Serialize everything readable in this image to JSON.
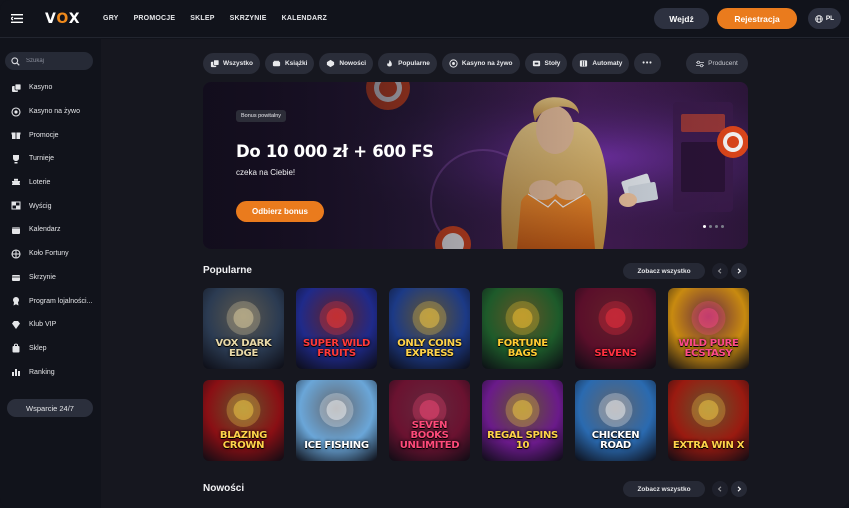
{
  "brand": {
    "logo_v": "V",
    "logo_o": "O",
    "logo_x": "X",
    "accent": "#ea7b1d"
  },
  "nav": [
    "GRY",
    "PROMOCJE",
    "SKLEP",
    "SKRZYNIE",
    "KALENDARZ"
  ],
  "header": {
    "login": "Wejdź",
    "register": "Rejestracja",
    "lang": "PL"
  },
  "search": {
    "placeholder": "Szukaj"
  },
  "sidebar": {
    "items": [
      {
        "label": "Kasyno",
        "icon": "dice-icon"
      },
      {
        "label": "Kasyno na żywo",
        "icon": "live-icon"
      },
      {
        "label": "Promocje",
        "icon": "gift-icon"
      },
      {
        "label": "Turnieje",
        "icon": "trophy-icon"
      },
      {
        "label": "Loterie",
        "icon": "ticket-icon"
      },
      {
        "label": "Wyścig",
        "icon": "flag-icon"
      },
      {
        "label": "Kalendarz",
        "icon": "calendar-icon"
      },
      {
        "label": "Koło Fortuny",
        "icon": "wheel-icon"
      },
      {
        "label": "Skrzynie",
        "icon": "chest-icon"
      },
      {
        "label": "Program lojalności...",
        "icon": "loyalty-icon"
      },
      {
        "label": "Klub VIP",
        "icon": "diamond-icon"
      },
      {
        "label": "Sklep",
        "icon": "bag-icon"
      },
      {
        "label": "Ranking",
        "icon": "ranking-icon"
      }
    ],
    "support": "Wsparcie 24/7"
  },
  "categories": [
    {
      "label": "Wszystko"
    },
    {
      "label": "Książki"
    },
    {
      "label": "Nowości"
    },
    {
      "label": "Popularne"
    },
    {
      "label": "Kasyno na żywo"
    },
    {
      "label": "Stoły"
    },
    {
      "label": "Automaty"
    }
  ],
  "more_label": "•••",
  "producer": "Producent",
  "hero": {
    "badge": "Bonus powitalny",
    "title": "Do 10 000 zł + 600 FS",
    "subtitle": "czeka na Ciebie!",
    "cta": "Odbierz bonus"
  },
  "sections": {
    "popular": "Popularne",
    "new": "Nowości",
    "see_all": "Zobacz wszystko"
  },
  "games": [
    {
      "name": "VOX DARK EDGE",
      "bg": "#2b3b52",
      "fg": "#e8d9a8"
    },
    {
      "name": "SUPER WILD FRUITS",
      "bg": "#1f2a8a",
      "fg": "#ff3a3a"
    },
    {
      "name": "ONLY COINS EXPRESS",
      "bg": "#1c3a86",
      "fg": "#ffd34a"
    },
    {
      "name": "FORTUNE BAGS",
      "bg": "#1d5a2a",
      "fg": "#ffcc33"
    },
    {
      "name": "SEVENS",
      "bg": "#5a0f2a",
      "fg": "#ff3040"
    },
    {
      "name": "WILD PURE ECSTASY",
      "bg": "#c88a10",
      "fg": "#ff4a8a"
    },
    {
      "name": "BLAZING CROWN",
      "bg": "#8a0f14",
      "fg": "#ffd34a"
    },
    {
      "name": "ICE FISHING",
      "bg": "#6aa6d8",
      "fg": "#ffffff"
    },
    {
      "name": "SEVEN BOOKS UNLIMITED",
      "bg": "#6a1230",
      "fg": "#ff4a7a"
    },
    {
      "name": "REGAL SPINS 10",
      "bg": "#6a1a8a",
      "fg": "#ffd34a"
    },
    {
      "name": "CHICKEN ROAD",
      "bg": "#2a6ab0",
      "fg": "#ffffff"
    },
    {
      "name": "EXTRA WIN X",
      "bg": "#9a1a10",
      "fg": "#ffd34a"
    }
  ]
}
